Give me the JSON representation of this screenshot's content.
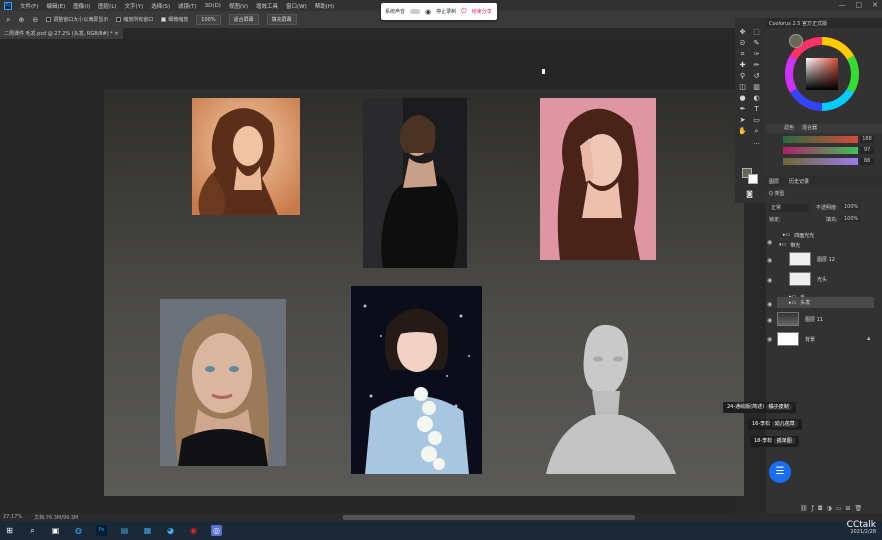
{
  "menu": {
    "logo": "Ps",
    "items": [
      "文件(F)",
      "编辑(E)",
      "图像(I)",
      "图层(L)",
      "文字(Y)",
      "选择(S)",
      "滤镜(T)",
      "3D(D)",
      "视图(V)",
      "增效工具",
      "窗口(W)",
      "帮助(H)"
    ]
  },
  "window_controls": [
    "—",
    "□",
    "✕"
  ],
  "options_bar": {
    "resize_windows": "调整窗口大小以满屏显示",
    "zoom_all": "缩放所有窗口",
    "scrubby_zoom": "细微缩放",
    "zoom_value": "100%",
    "fit_screen": "适合屏幕",
    "fill_screen": "填充屏幕"
  },
  "document_tab": "二周课件 毛发.psd @ 27.2% (头发, RGB/8#) * ✕",
  "recording_bar": {
    "system_sound": "系统声音",
    "stop": "停止录制",
    "exit": "结束分享"
  },
  "color_panel": {
    "header": "Coolorus 2.5 官方正式版",
    "tabs": [
      "滤色",
      "混合器"
    ],
    "values": [
      "188",
      "97",
      "88"
    ]
  },
  "layers_panel": {
    "tabs": [
      "图层",
      "历史记录"
    ],
    "kind_filter": "Q 类型",
    "blend_mode": "正常",
    "opacity_label": "不透明度:",
    "opacity": "100%",
    "lock_label": "锁定:",
    "fill_label": "填充:",
    "fill": "100%",
    "layers": [
      {
        "name": "四面光光",
        "type": "group"
      },
      {
        "name": "带光",
        "type": "group"
      },
      {
        "name": "图层 12",
        "type": "layer"
      },
      {
        "name": "光头",
        "type": "layer"
      },
      {
        "name": "毛",
        "type": "group"
      },
      {
        "name": "头发",
        "type": "group"
      },
      {
        "name": "图层 11",
        "type": "layer"
      },
      {
        "name": "背景",
        "type": "layer"
      }
    ]
  },
  "lesson_popups": [
    {
      "num": "24-通绘版(简述)",
      "name": "橘子皮制"
    },
    {
      "num": "16-李松",
      "name": "幼儿花草"
    },
    {
      "num": "18-李松",
      "name": "孤单图"
    }
  ],
  "status_bar": {
    "zoom": "27.17%",
    "doc": "文档:76.3M/99.3M"
  },
  "tray": {
    "brand": "CCtalk",
    "date": "2021/2/28"
  },
  "colors": {
    "ps_blue": "#31a8ff",
    "accent_red": "#e0245e",
    "chat_blue": "#1a6ef5"
  }
}
